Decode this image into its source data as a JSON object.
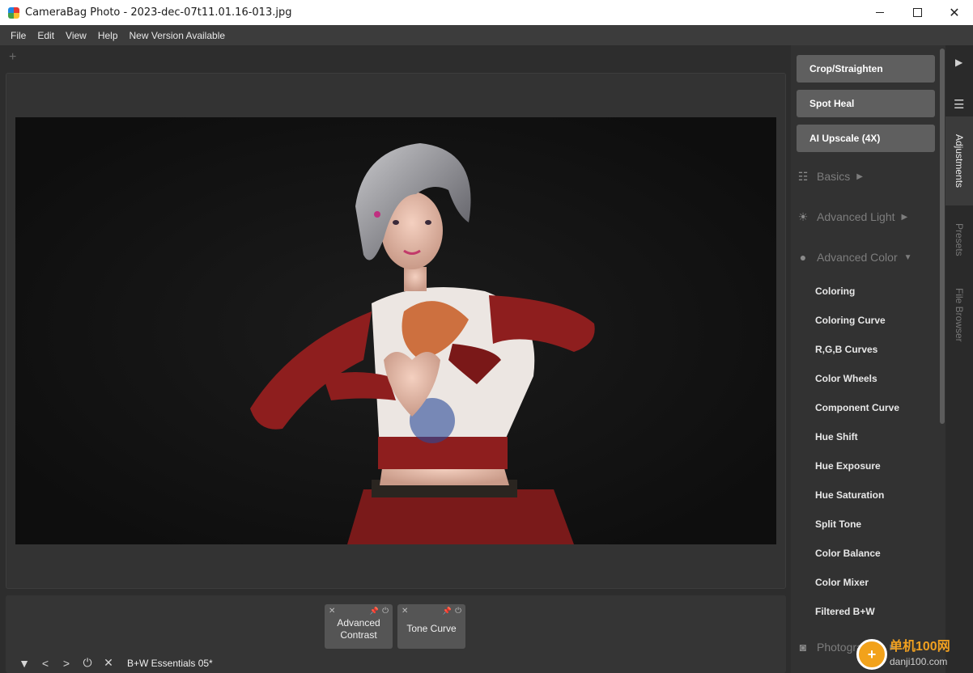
{
  "window": {
    "title": "CameraBag Photo - 2023-dec-07t11.01.16-013.jpg",
    "buttons": {
      "minimize": "—",
      "maximize": "☐",
      "close": "✕"
    }
  },
  "menu": [
    "File",
    "Edit",
    "View",
    "Help",
    "New Version Available"
  ],
  "canvas": {
    "add_tab": "+"
  },
  "tools": {
    "crop": "Crop/Straighten",
    "spot_heal": "Spot Heal",
    "ai_upscale": "AI Upscale (4X)"
  },
  "sections": {
    "basics": "Basics",
    "advanced_light": "Advanced Light",
    "advanced_color": "Advanced Color",
    "photographic": "Photographic"
  },
  "advanced_color_items": [
    "Coloring",
    "Coloring Curve",
    "R,G,B Curves",
    "Color Wheels",
    "Component Curve",
    "Hue Shift",
    "Hue Exposure",
    "Hue Saturation",
    "Split Tone",
    "Color Balance",
    "Color Mixer",
    "Filtered B+W"
  ],
  "side_tabs": {
    "adjustments": "Adjustments",
    "presets": "Presets",
    "file_browser": "File Browser"
  },
  "applied_adjustments": [
    {
      "label": "Advanced Contrast"
    },
    {
      "label": "Tone Curve"
    }
  ],
  "bottom": {
    "preset_name": "B+W Essentials 05*"
  },
  "watermark": {
    "line1": "单机100网",
    "line2": "danji100.com"
  },
  "colors": {
    "accent_button": "#5f5f5f",
    "panel": "#323232",
    "background": "#2d2d2d"
  }
}
